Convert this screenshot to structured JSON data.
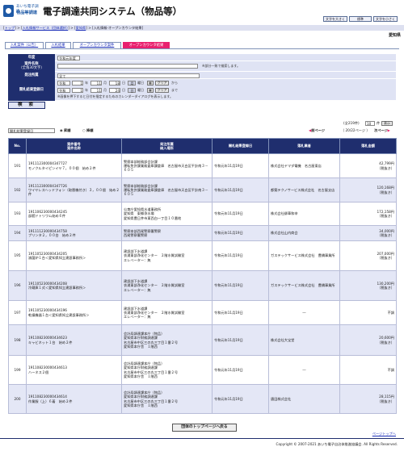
{
  "header": {
    "logo_line1": "あいち",
    "logo_line2": "電子調達",
    "logo_line3": "物品等調達",
    "system_title": "電子調達共同システム（物品等）",
    "text_size_buttons": [
      "文字を大きく",
      "標準",
      "文字を小さく"
    ]
  },
  "breadcrumb": {
    "items": [
      "トップ",
      "入札情報サービス（団体選択）",
      "愛知県"
    ],
    "current": "入札情報-オープンカウンタ結果"
  },
  "organization": "愛知県",
  "tabs": [
    "入札案件（公告）",
    "入札結果",
    "オープンカウンタ案件",
    "オープンカウンタ結果"
  ],
  "form": {
    "year_label": "年度",
    "year_value": "令和元年度",
    "name_label": "案件名称",
    "name_sub": "（全角30文字）",
    "name_note": "※部分一致で検索します。",
    "org_label": "発注所属",
    "org_value": "全て",
    "date_label": "開札結果登録日",
    "era": "令和",
    "from": {
      "year": "1",
      "month": "11",
      "day": "18",
      "weekday": "月"
    },
    "to": {
      "year": "1",
      "month": "11",
      "day": "24",
      "weekday": "日"
    },
    "year_unit": "年",
    "month_unit": "月",
    "day_unit": "日",
    "weekday_unit": "曜日",
    "clear_label": "クリア",
    "from_suffix": "から",
    "to_suffix": "まで",
    "cal_hint": "※画像を押下すると日付を指定するためのカレンダーダイアログを表示します。",
    "search_button": "検 索"
  },
  "results_controls": {
    "sort_value": "開札結果登録日",
    "order_asc": "昇順",
    "order_desc": "降順",
    "total": "(全219件)",
    "per_page_value": "10",
    "per_page_unit": "件",
    "display_button": "表示",
    "prev_label": "前ページ",
    "page_info": "（ 20/22ページ ）",
    "next_label": "次ページ"
  },
  "table": {
    "headers": {
      "no": "No.",
      "case": [
        "案件番号",
        "案件名称"
      ],
      "org": [
        "発注所属",
        "納入場所"
      ],
      "date": "開札結果登録日",
      "winner": "落札業者",
      "amount": "落札金額"
    },
    "rows": [
      {
        "no": "191",
        "num": "191112300004347727",
        "name": "モノクルタイピンイヤ７，００個　始め２件",
        "org": [
          "警察本部総務部会計課",
          "運転免許課業務倉庫課倉庫　名古屋市天白区平針南３－６０５"
        ],
        "date": "令和元年11月19日",
        "winner": "株式会社ヤマダ電機　名古屋東店",
        "amount": "42,799円",
        "note": "（税抜き）"
      },
      {
        "no": "192",
        "num": "191112300004347726",
        "name": "ワイヤレスヘッドフォン（取替機付き）３，００個　始め２件",
        "org": [
          "警察本部総務部会計課",
          "運転免許課業務倉庫課倉庫　名古屋市天白区平針南３－６０５"
        ],
        "date": "令和元年11月19日",
        "winner": "都築テクノサービス株式会社　名古屋支店",
        "amount": "120,168円",
        "note": "（税抜き）"
      },
      {
        "no": "193",
        "num": "191106230000434245",
        "name": "部館ドトリワム始め６件",
        "org": [
          "公衆庁愛知県水道事務所",
          "愛知県　東郷浄水場",
          "愛知県豊日井市東西白一丁目１０番地"
        ],
        "date": "令和元年11月19日",
        "winner": "株式会社柳華和申",
        "amount": "172,158円",
        "note": "（税抜き）"
      },
      {
        "no": "194",
        "num": "191111230000434758",
        "name": "プリンタ２，００台　始め２件",
        "org": [
          "警察本部西尾警察署警察",
          "西尾警察署警察"
        ],
        "date": "令和元年11月19日",
        "winner": "株式会社山内商会",
        "amount": "34,000円",
        "note": "（税抜き）"
      },
      {
        "no": "195",
        "num": "191105230000434205",
        "name": "滅菌炉１台＜愛知県知立建設事務所＞",
        "org": [
          "建設部下水道課",
          "衣浦東部浄化センター　２階水質試験室",
          "エレベーター：無"
        ],
        "date": "令和元年11月19日",
        "winner": "ガステックサービス株式会社　豊橋事業所",
        "amount": "207,000円",
        "note": "（税抜き）"
      },
      {
        "no": "196",
        "num": "191105230000434208",
        "name": "冷蔵庫１式＜愛知県知立建設事務所＞",
        "org": [
          "建設部下水道課",
          "衣浦東部浄化センター　２階水質試験室",
          "エレベーター：無"
        ],
        "date": "令和元年11月19日",
        "winner": "ガステックサービス株式会社　豊橋事業所",
        "amount": "130,200円",
        "note": "（税抜き）"
      },
      {
        "no": "197",
        "num": "191105230000434196",
        "name": "乾燥機器１台＜愛知県知立建設事務所＞",
        "org": [
          "建設部下水道課",
          "衣浦東部浄化センター　２階水質試験室",
          "エレベーター：無"
        ],
        "date": "令和元年11月19日",
        "winner": "―",
        "amount": "不調",
        "note": ""
      },
      {
        "no": "198",
        "num": "191108230000434623",
        "name": "キャビネット１台　始め２件",
        "org": [
          "会計局調達課本庁（物品）",
          "愛知県本庁財務調達課",
          "名古屋市中区三の丸三丁目１番２号",
          "愛知県本庁舎　１階西"
        ],
        "date": "令和元年11月19日",
        "winner": "株式会社大宝堂",
        "amount": "20,600円",
        "note": "（税抜き）"
      },
      {
        "no": "199",
        "num": "191108230000434613",
        "name": "ハーネス２個",
        "org": [
          "会計局調達課本庁（物品）",
          "愛知県本庁財務調達課",
          "名古屋市中区三の丸三丁目１番２号",
          "愛知県本庁舎　１階西"
        ],
        "date": "令和元年11月19日",
        "winner": "―",
        "amount": "不調",
        "note": ""
      },
      {
        "no": "200",
        "num": "191108230000434614",
        "name": "作業服（上）６着　始め２件",
        "org": [
          "会計局調達課本庁（物品）",
          "愛知県本庁財務調達課",
          "名古屋市中区三の丸三丁目１番２号",
          "愛知県本庁舎　１階西"
        ],
        "date": "令和元年11月19日",
        "winner": "唐田株式会社",
        "amount": "28,115円",
        "note": "（税抜き）"
      }
    ]
  },
  "back_button": "団体のトップページへ戻る",
  "page_top": "ページトップへ",
  "footer": "Copyright © 2007-2021 あいち電子自治体推進協議会. All Rights Reserved."
}
